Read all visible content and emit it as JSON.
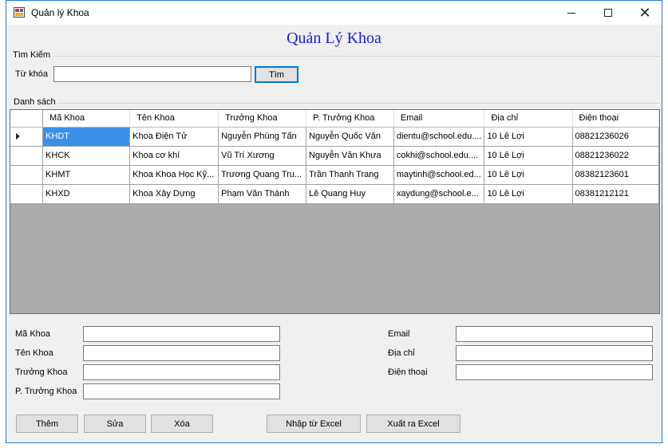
{
  "window": {
    "title": "Quản lý Khoa"
  },
  "heading": "Quản Lý Khoa",
  "search": {
    "group_label": "Tìm Kiếm",
    "keyword_label": "Từ khóa",
    "keyword_value": "",
    "search_button": "Tìm"
  },
  "list": {
    "group_label": "Danh sách",
    "columns": [
      "Mã Khoa",
      "Tên Khoa",
      "Trưởng Khoa",
      "P. Trưởng Khoa",
      "Email",
      "Địa chỉ",
      "Điện thoại"
    ],
    "rows": [
      [
        "KHDT",
        "Khoa Điện Tử",
        "Nguyễn Phùng Tấn",
        "Nguyễn Quốc Văn",
        "dientu@school.edu....",
        "10 Lê Lợi",
        "08821236026"
      ],
      [
        "KHCK",
        "Khoa cơ khí",
        "Vũ Trí Xương",
        "Nguyễn Văn Khưa",
        "cokhi@school.edu....",
        "10 Lê Lợi",
        "08821236022"
      ],
      [
        "KHMT",
        "Khoa  Khoa Học Kỹ...",
        "Trương Quang Tru...",
        "Trần Thanh Trang",
        "maytinh@school.ed...",
        "10 Lê Lợi",
        "08382123601"
      ],
      [
        "KHXD",
        "Khoa Xây Dựng",
        "Phạm Văn Thành",
        "Lê Quang Huy",
        "xaydung@school.e...",
        "10 Lê Lợi",
        "08381212121"
      ]
    ],
    "selected_row": 0
  },
  "form": {
    "ma_khoa_label": "Mã Khoa",
    "ten_khoa_label": "Tên Khoa",
    "truong_khoa_label": "Trưởng Khoa",
    "pho_truong_khoa_label": "P. Trưởng Khoa",
    "email_label": "Email",
    "dia_chi_label": "Địa chỉ",
    "dien_thoai_label": "Điện thoại"
  },
  "buttons": {
    "add": "Thêm",
    "edit": "Sửa",
    "delete": "Xóa",
    "import_excel": "Nhập từ Excel",
    "export_excel": "Xuất ra Excel"
  },
  "colors": {
    "heading": "#1a1adf",
    "selection": "#3b8fe8",
    "window_border": "#1b7fd6",
    "grid_empty": "#ababab"
  }
}
